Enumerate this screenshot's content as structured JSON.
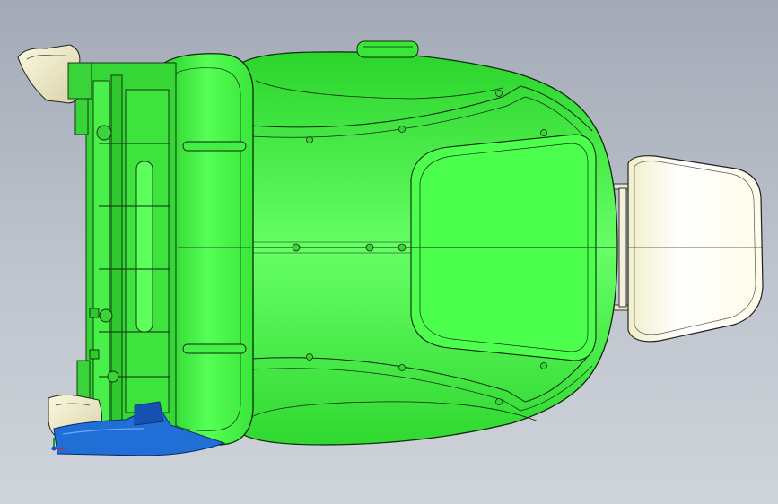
{
  "viewport": {
    "background_top": "#a3aab6",
    "background_bottom": "#cfd3da"
  },
  "model": {
    "parts": [
      {
        "name": "seat-cushion",
        "color": "#3ae63a"
      },
      {
        "name": "seat-frame-mechanism",
        "color": "#38d838"
      },
      {
        "name": "headrest",
        "color": "#fffbe6"
      },
      {
        "name": "side-trim-plastic",
        "color": "#1f6fd6"
      },
      {
        "name": "recliner-handles",
        "color": "#f2ecc8"
      }
    ],
    "outline_color": "#0d2a0d"
  },
  "triad_colors": {
    "x": "#e02020",
    "y": "#1fa01f",
    "z": "#2040e0"
  }
}
